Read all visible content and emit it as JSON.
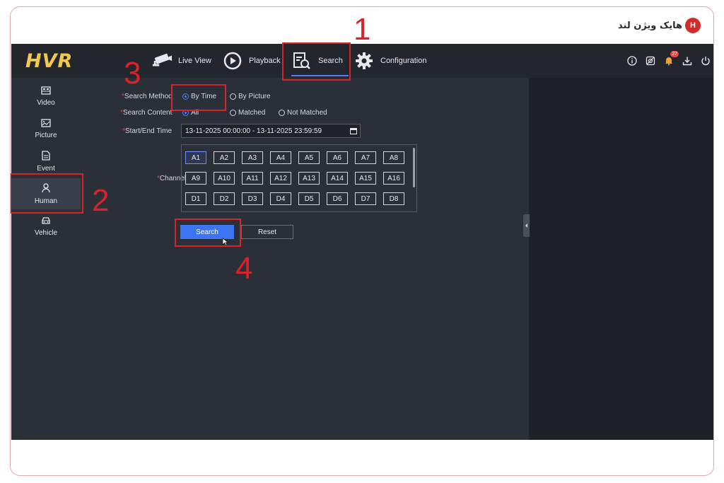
{
  "watermark": {
    "brand": "هایک ویژن لند",
    "badge": "H"
  },
  "app": {
    "logo": "HVR"
  },
  "nav": [
    {
      "label": "Live View",
      "icon": "camera-icon"
    },
    {
      "label": "Playback",
      "icon": "playback-icon"
    },
    {
      "label": "Search",
      "icon": "search-doc-icon",
      "active": true
    },
    {
      "label": "Configuration",
      "icon": "gear-icon"
    }
  ],
  "header_icons": {
    "alarm_count": "27"
  },
  "sidebar": {
    "items": [
      {
        "label": "Video",
        "icon": "video-icon"
      },
      {
        "label": "Picture",
        "icon": "picture-icon"
      },
      {
        "label": "Event",
        "icon": "event-icon"
      },
      {
        "label": "Human",
        "icon": "human-icon",
        "active": true
      },
      {
        "label": "Vehicle",
        "icon": "vehicle-icon"
      }
    ]
  },
  "form": {
    "required_mark": "*",
    "search_method": {
      "label": "Search Method",
      "options": [
        "By Time",
        "By Picture"
      ],
      "selected": "By Time"
    },
    "search_content": {
      "label": "Search Content",
      "options": [
        "All",
        "Matched",
        "Not Matched"
      ],
      "selected": "All"
    },
    "time": {
      "label": "Start/End Time",
      "value": "13-11-2025 00:00:00 - 13-11-2025 23:59:59"
    },
    "channel": {
      "label": "Channel",
      "rows": [
        [
          "A1",
          "A2",
          "A3",
          "A4",
          "A5",
          "A6",
          "A7",
          "A8"
        ],
        [
          "A9",
          "A10",
          "A11",
          "A12",
          "A13",
          "A14",
          "A15",
          "A16"
        ],
        [
          "D1",
          "D2",
          "D3",
          "D4",
          "D5",
          "D6",
          "D7",
          "D8"
        ]
      ],
      "selected": "A1"
    },
    "buttons": {
      "search": "Search",
      "reset": "Reset"
    }
  },
  "annotations": [
    "1",
    "2",
    "3",
    "4"
  ],
  "colors": {
    "accent": "#3d74f0",
    "callout": "#d9232a",
    "logo": "#f2c94c",
    "topbar": "#23262d",
    "panel": "#2b2f38"
  }
}
